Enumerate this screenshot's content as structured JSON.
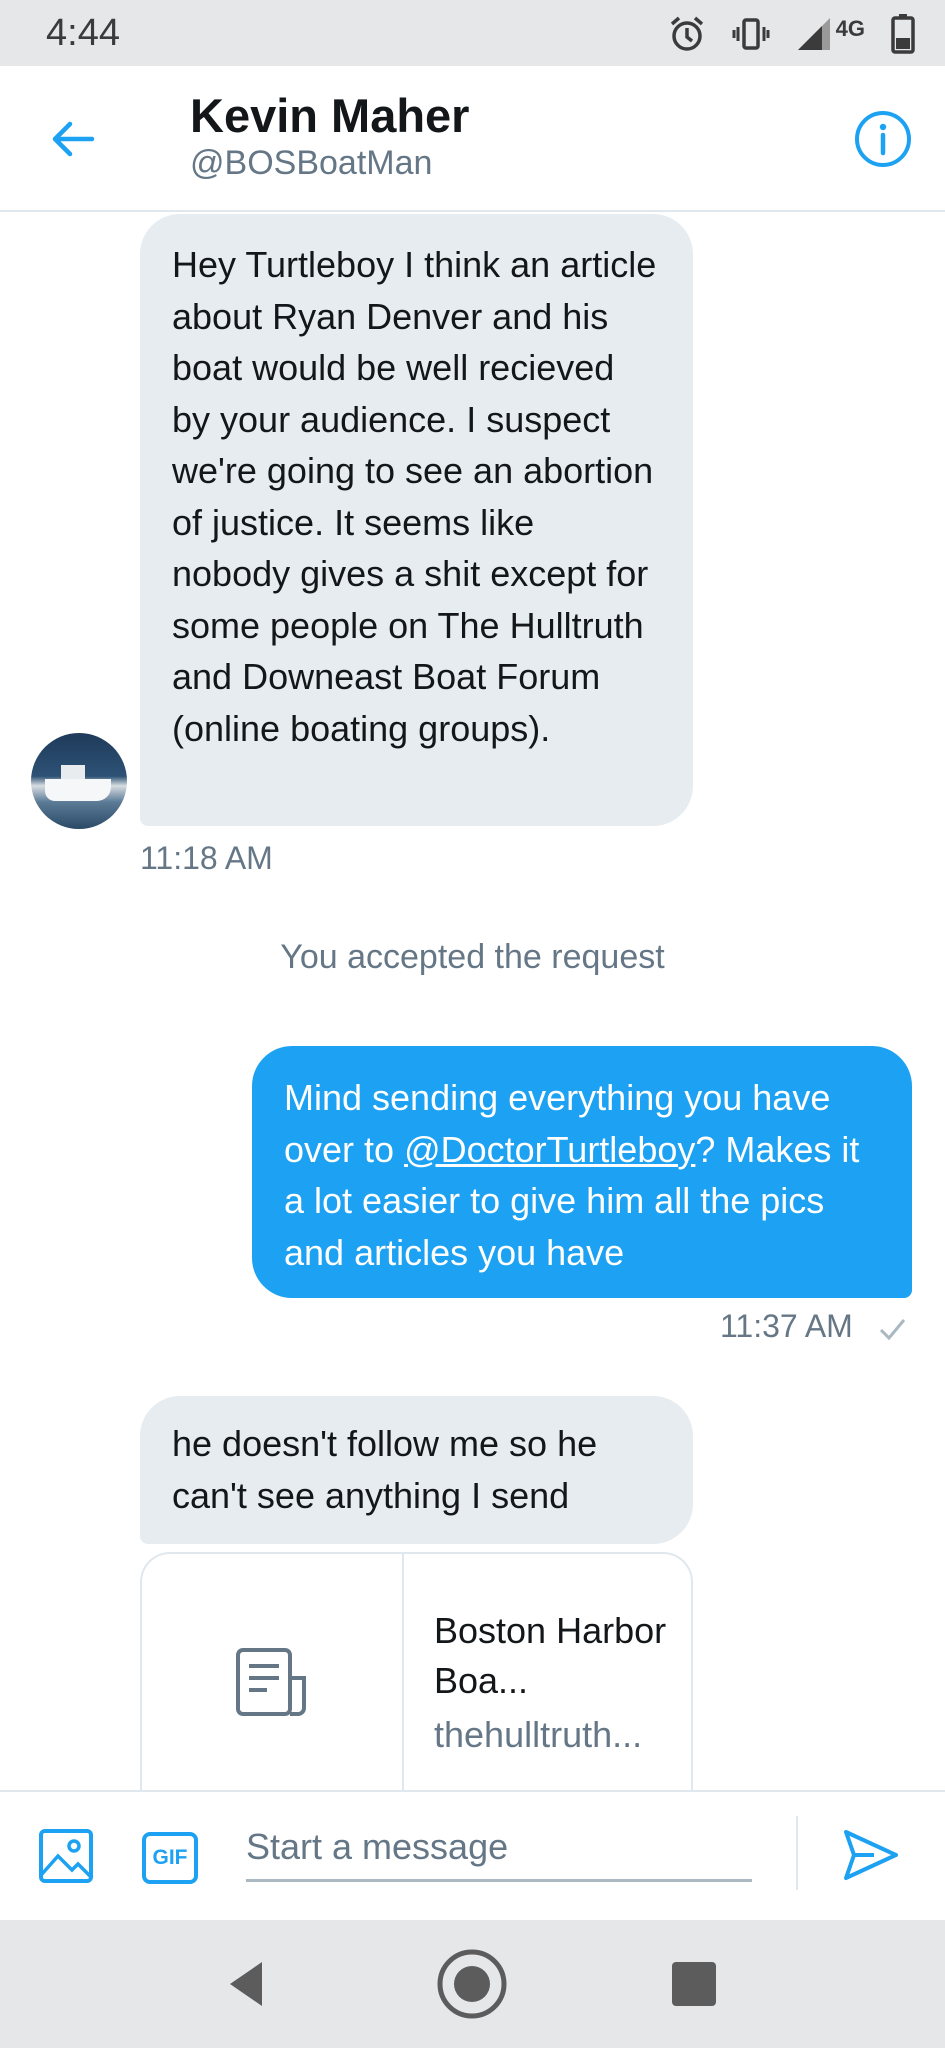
{
  "status_bar": {
    "time": "4:44",
    "network_label": "4G",
    "icons": [
      "alarm-icon",
      "vibrate-icon",
      "signal-icon",
      "battery-icon"
    ]
  },
  "header": {
    "name": "Kevin Maher",
    "handle": "@BOSBoatMan",
    "icons": [
      "back-arrow-icon",
      "info-icon"
    ]
  },
  "messages": [
    {
      "direction": "incoming",
      "text": "Hey Turtleboy I think an article about Ryan Denver and his boat would be well recieved by your audience. I suspect we're going to see an abortion of justice. It seems like nobody gives a shit except for some people on The Hulltruth and Downeast Boat Forum (online boating groups).",
      "time": "11:18 AM"
    },
    {
      "direction": "system",
      "text": "You accepted the request"
    },
    {
      "direction": "outgoing",
      "text_before": "Mind sending everything you have over to ",
      "mention": "@DoctorTurtleboy",
      "text_after": "? Makes it a lot easier to give him all the pics and articles you have",
      "time": "11:37 AM",
      "status_icon": "checkmark-icon"
    },
    {
      "direction": "incoming",
      "text": "he doesn't follow me so he can't see anything I send",
      "link_card": {
        "title": "Boston Harbor Boa...",
        "domain": "thehulltruth..."
      }
    }
  ],
  "composer": {
    "placeholder": "Start a message",
    "gif_label": "GIF",
    "icons": [
      "image-icon",
      "gif-icon",
      "send-icon"
    ]
  },
  "colors": {
    "accent": "#1da1f2",
    "incoming_bubble": "#e6ecf0",
    "secondary_text": "#657786"
  }
}
